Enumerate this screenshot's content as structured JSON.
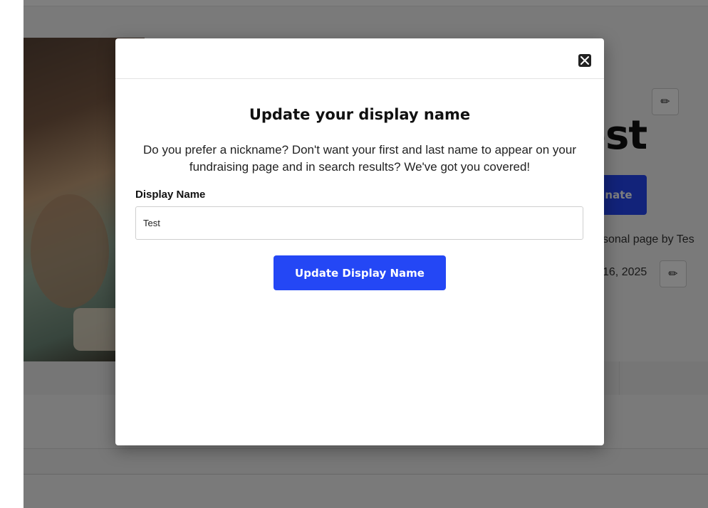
{
  "background_page": {
    "headline_fragment": "est",
    "donate_fragment": "nate",
    "personal_page_fragment": "sonal page by Tes",
    "date_fragment": "16, 2025",
    "edit_icon": "pencil-icon"
  },
  "modal": {
    "close_icon": "close-icon",
    "title": "Update your display name",
    "description": "Do you prefer a nickname? Don't want your first and last name to appear on your fundraising page and in search results? We've got you covered!",
    "field_label": "Display Name",
    "field_value": "Test",
    "submit_label": "Update Display Name"
  },
  "colors": {
    "accent": "#2447f5",
    "overlay": "rgba(0,0,0,0.5)"
  }
}
